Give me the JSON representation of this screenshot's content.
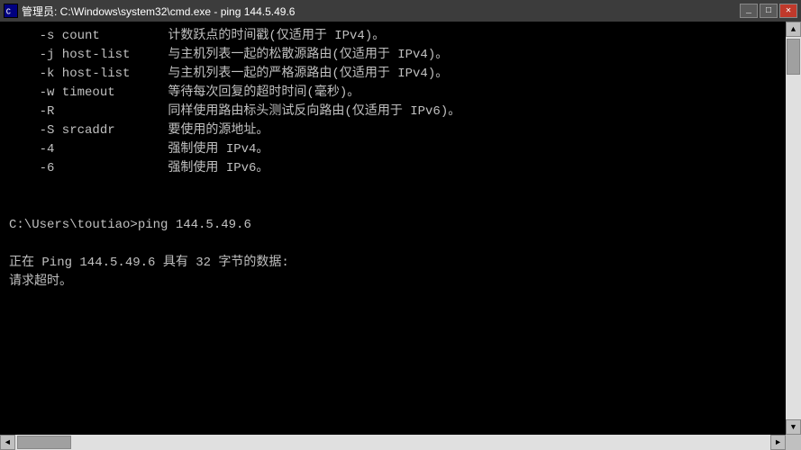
{
  "titlebar": {
    "title": "管理员: C:\\Windows\\system32\\cmd.exe - ping  144.5.49.6",
    "icon": "cmd-icon",
    "minimize_label": "_",
    "maximize_label": "□",
    "close_label": "✕"
  },
  "terminal": {
    "lines": [
      "    -s count         计数跃点的时间戳(仅适用于 IPv4)。",
      "    -j host-list     与主机列表一起的松散源路由(仅适用于 IPv4)。",
      "    -k host-list     与主机列表一起的严格源路由(仅适用于 IPv4)。",
      "    -w timeout       等待每次回复的超时时间(毫秒)。",
      "    -R               同样使用路由标头测试反向路由(仅适用于 IPv6)。",
      "    -S srcaddr       要使用的源地址。",
      "    -4               强制使用 IPv4。",
      "    -6               强制使用 IPv6。",
      "",
      "",
      "C:\\Users\\toutiao>ping 144.5.49.6",
      "",
      "正在 Ping 144.5.49.6 具有 32 字节的数据:",
      "请求超时。"
    ]
  }
}
